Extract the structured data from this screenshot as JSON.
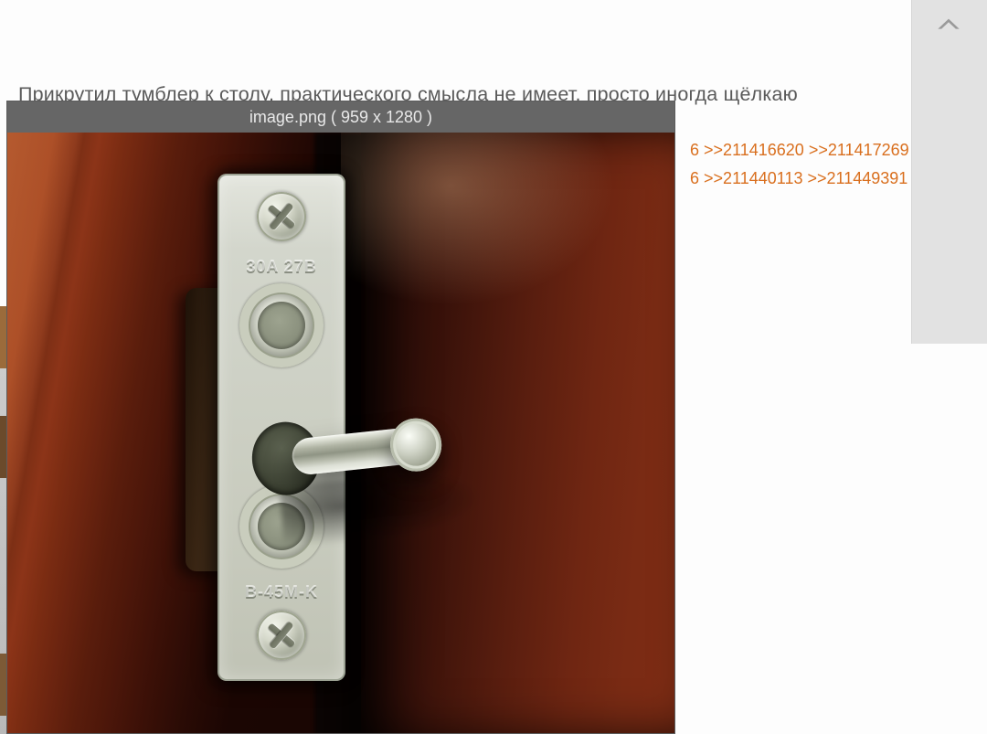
{
  "controls": {
    "scroll_top_title": "Scroll to top"
  },
  "post": {
    "text": "Прикрутил тумблер к столу, практического смысла не имеет, просто иногда щёлкаю"
  },
  "replies": {
    "line1_partial": "6",
    "line2_partial": "6",
    "items": [
      {
        "id": "211416620",
        "label": ">>211416620"
      },
      {
        "id": "211417269",
        "label": ">>211417269"
      },
      {
        "id": "211440113",
        "label": ">>211440113"
      },
      {
        "id": "211449391",
        "label": ">>211449391"
      }
    ]
  },
  "preview": {
    "filename": "image.png",
    "dimensions": "( 959 x 1280 )",
    "header_text": "image.png ( 959 x 1280 )",
    "plate_text_top": "30A 27B",
    "plate_text_bottom": "B-45М-K",
    "switch_alt": "Metal toggle switch screwed to wooden desk edge"
  }
}
